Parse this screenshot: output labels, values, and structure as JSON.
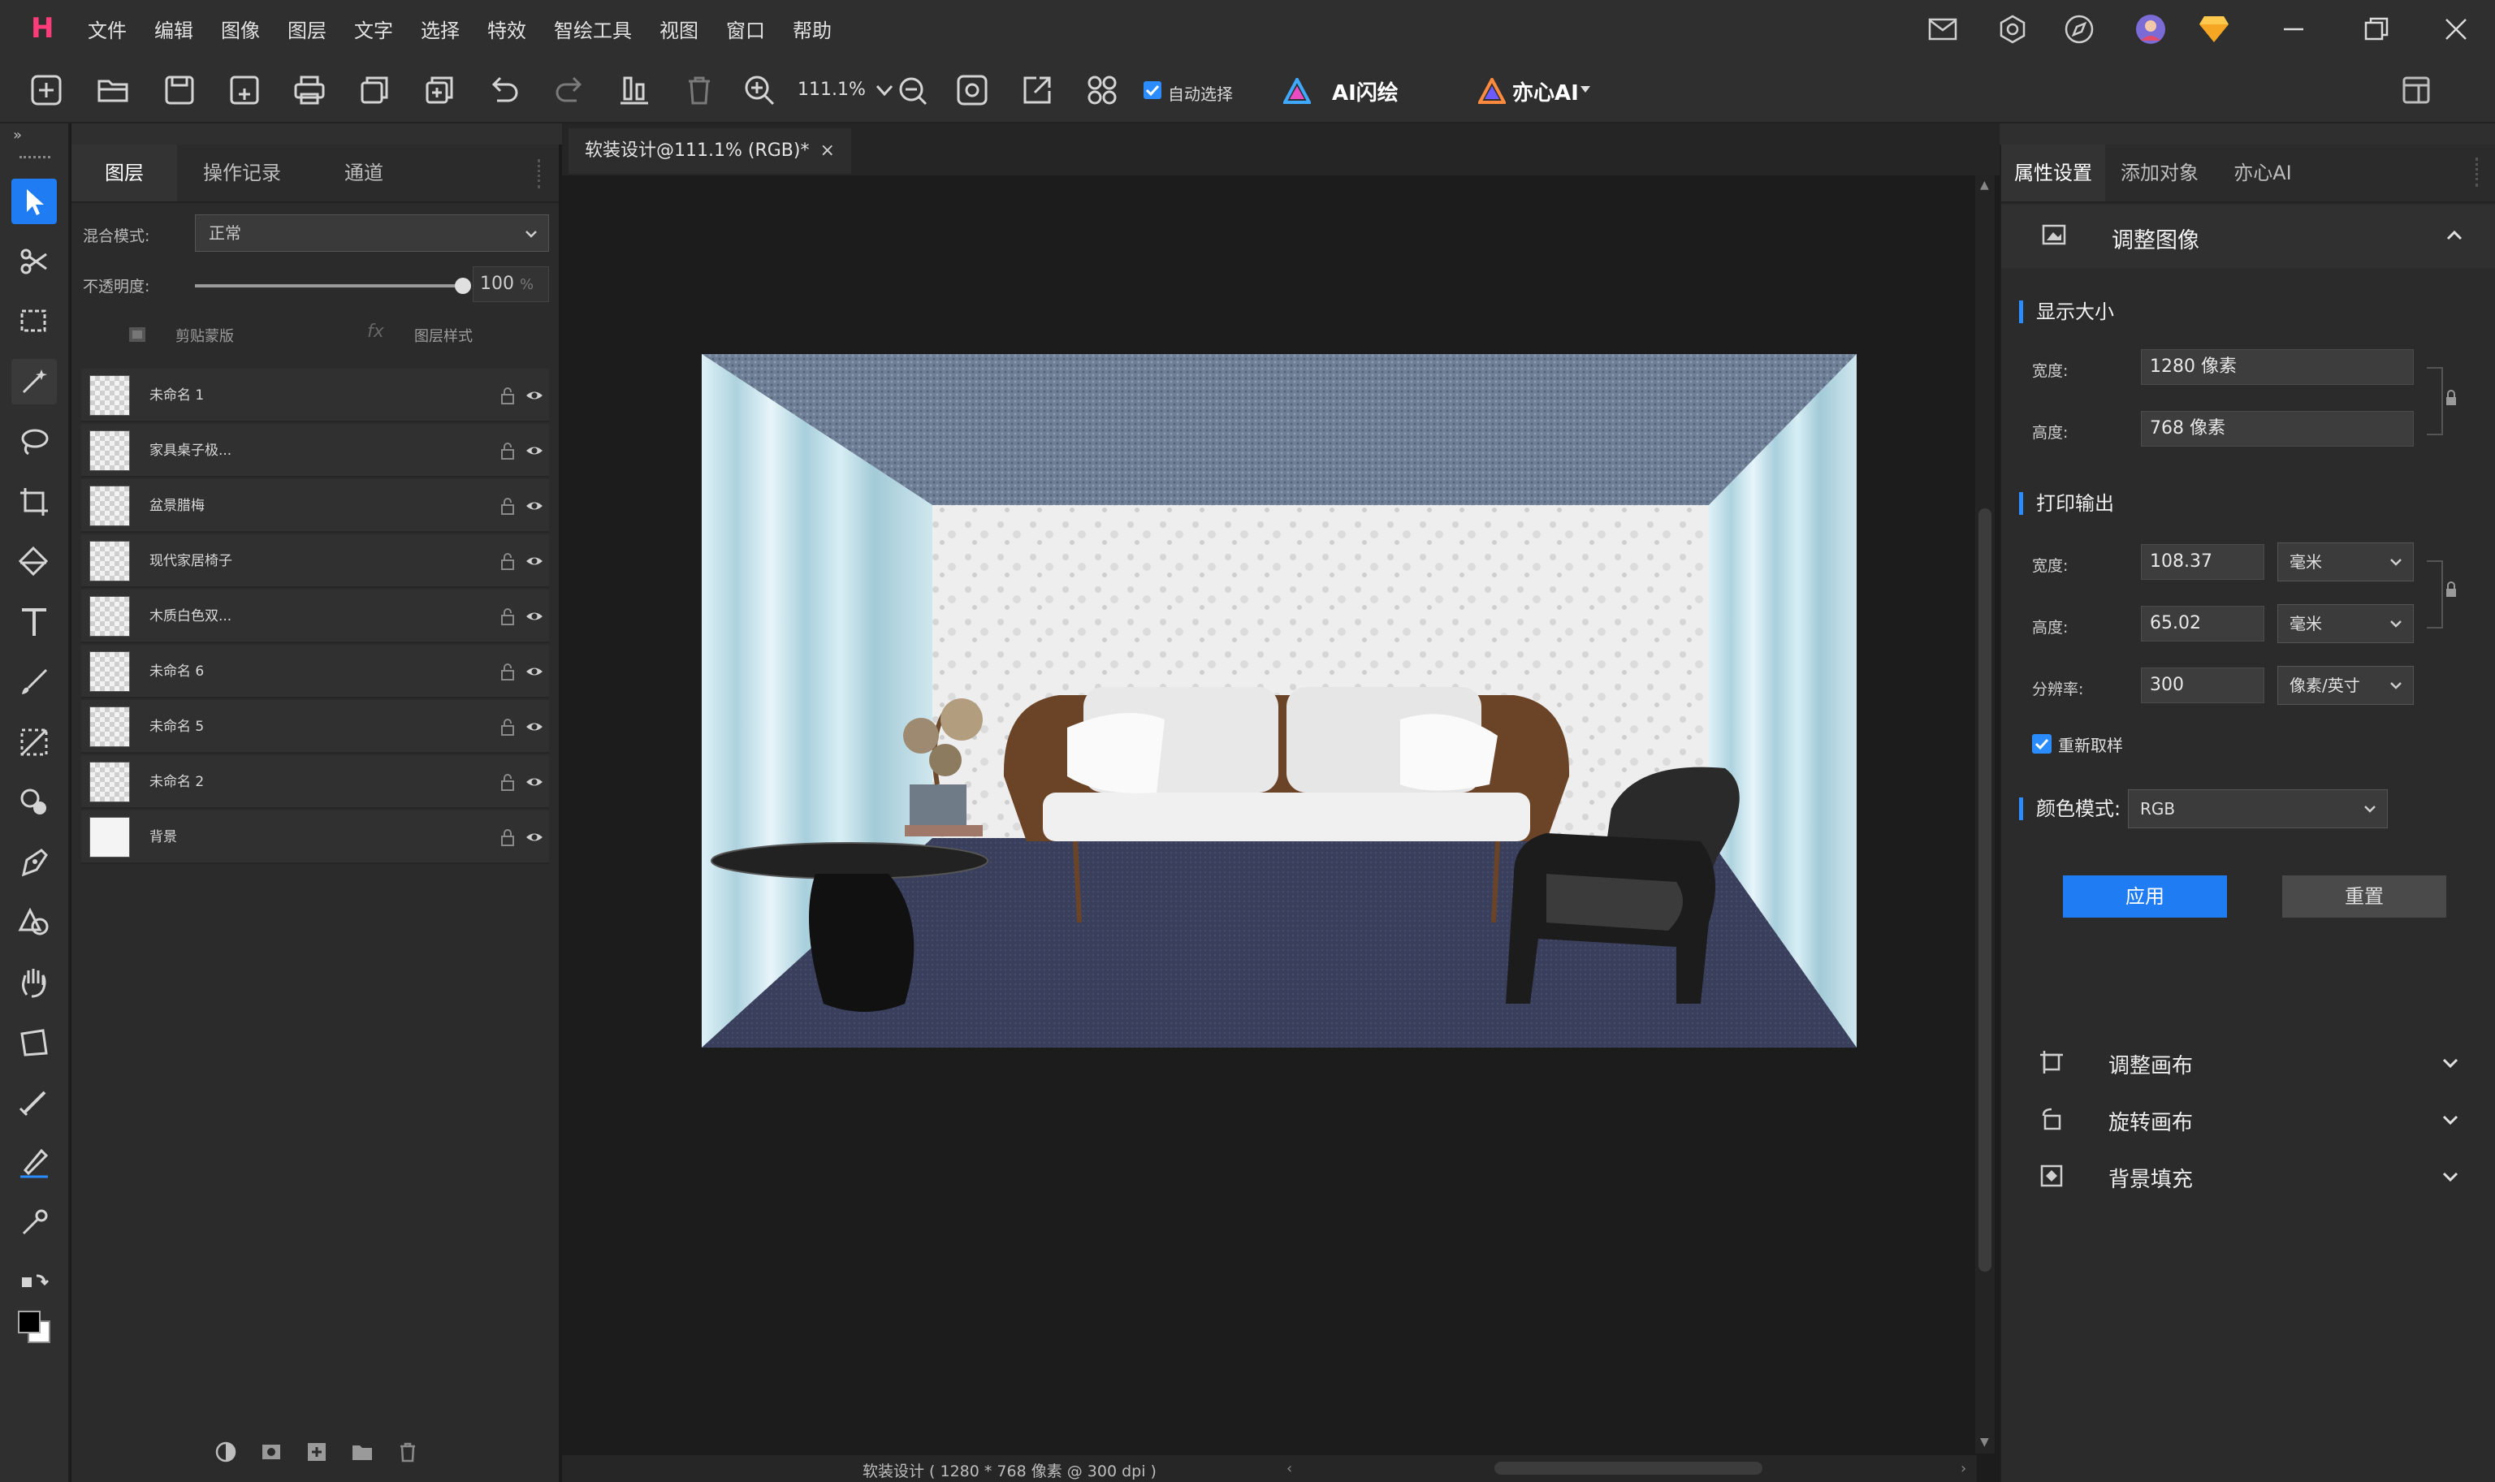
{
  "menubar": {
    "logo": "H",
    "items": [
      "文件",
      "编辑",
      "图像",
      "图层",
      "文字",
      "选择",
      "特效",
      "智绘工具",
      "视图",
      "窗口",
      "帮助"
    ]
  },
  "toolbar": {
    "zoom": "111.1%",
    "auto_select_label": "自动选择",
    "ai_flash_label": "AI闪绘",
    "yixin_ai_label": "亦心AI"
  },
  "layers_panel": {
    "tabs": [
      "图层",
      "操作记录",
      "通道"
    ],
    "blend_label": "混合模式:",
    "blend_value": "正常",
    "opacity_label": "不透明度:",
    "opacity_value": "100",
    "opacity_unit": "%",
    "opacity_fraction": 1.0,
    "clip_mask_label": "剪贴蒙版",
    "layer_style_label": "图层样式",
    "layers": [
      {
        "name": "未命名 1"
      },
      {
        "name": "家具桌子极..."
      },
      {
        "name": "盆景腊梅"
      },
      {
        "name": "现代家居椅子"
      },
      {
        "name": "木质白色双..."
      },
      {
        "name": "未命名 6"
      },
      {
        "name": "未命名 5"
      },
      {
        "name": "未命名 2"
      },
      {
        "name": "背景"
      }
    ]
  },
  "document": {
    "tab_title": "软装设计@111.1% (RGB)*",
    "status": "软装设计 ( 1280 * 768 像素 @ 300 dpi )"
  },
  "right_panel": {
    "tabs": [
      "属性设置",
      "添加对象",
      "亦心AI"
    ],
    "header": "调整图像",
    "display_size_title": "显示大小",
    "width_label": "宽度:",
    "height_label": "高度:",
    "display_width": "1280 像素",
    "display_height": "768 像素",
    "print_title": "打印输出",
    "print_width": "108.37",
    "print_height": "65.02",
    "unit_mm": "毫米",
    "resolution_label": "分辨率:",
    "resolution": "300",
    "resolution_unit": "像素/英寸",
    "resample_label": "重新取样",
    "color_mode_label": "颜色模式:",
    "color_mode": "RGB",
    "apply_label": "应用",
    "reset_label": "重置",
    "accordions": [
      "调整画布",
      "旋转画布",
      "背景填充"
    ]
  },
  "colors": {
    "accent": "#1f7cf2",
    "logo": "#ff3c7a"
  }
}
